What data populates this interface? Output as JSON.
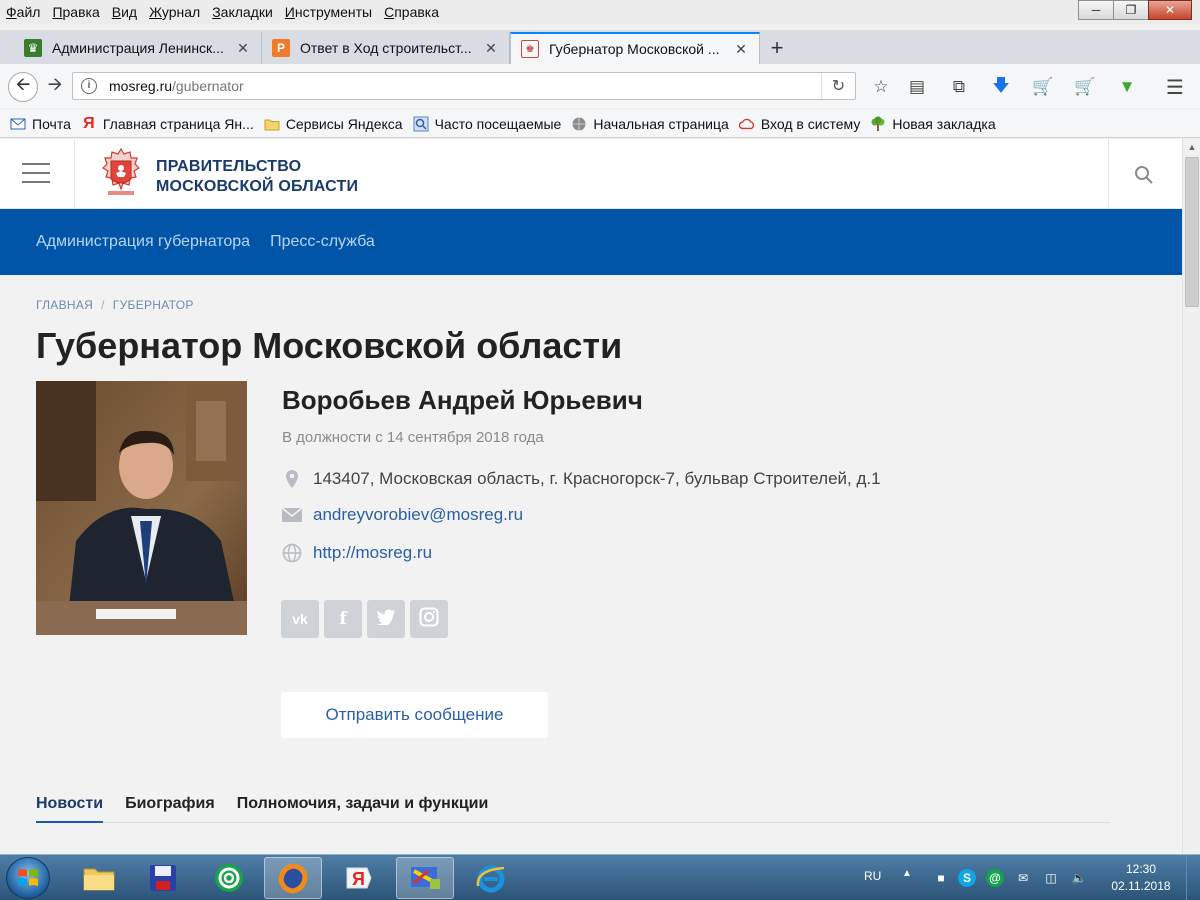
{
  "browser": {
    "menu": [
      "Файл",
      "Правка",
      "Вид",
      "Журнал",
      "Закладки",
      "Инструменты",
      "Справка"
    ],
    "tabs": [
      {
        "title": "Администрация Ленинск...",
        "active": false
      },
      {
        "title": "Ответ в Ход строительст...",
        "active": false
      },
      {
        "title": "Губернатор Московской ...",
        "active": true
      }
    ],
    "url": {
      "host": "mosreg.ru",
      "path": "/gubernator"
    },
    "bookmarks": [
      {
        "label": "Почта"
      },
      {
        "label": "Главная страница Ян..."
      },
      {
        "label": "Сервисы Яндекса"
      },
      {
        "label": "Часто посещаемые"
      },
      {
        "label": "Начальная страница"
      },
      {
        "label": "Вход в систему"
      },
      {
        "label": "Новая закладка"
      }
    ]
  },
  "site": {
    "title_line1": "ПРАВИТЕЛЬСТВО",
    "title_line2": "МОСКОВСКОЙ ОБЛАСТИ",
    "subnav": [
      "Администрация губернатора",
      "Пресс-служба"
    ],
    "breadcrumb": [
      "ГЛАВНАЯ",
      "ГУБЕРНАТОР"
    ],
    "page_title": "Губернатор Московской области",
    "governor": {
      "name": "Воробьев Андрей Юрьевич",
      "tenure": "В должности с 14 сентября 2018 года",
      "address": "143407, Московская область, г. Красногорск-7, бульвар Строителей, д.1",
      "email": "andreyvorobiev@mosreg.ru",
      "website": "http://mosreg.ru"
    },
    "send_button": "Отправить сообщение",
    "tabs": [
      "Новости",
      "Биография",
      "Полномочия, задачи и функции"
    ]
  },
  "taskbar": {
    "lang": "RU",
    "time": "12:30",
    "date": "02.11.2018"
  },
  "colors": {
    "subnav_bg": "#0055a8",
    "link": "#2a5fa4",
    "tab_accent": "#0a84ff"
  }
}
